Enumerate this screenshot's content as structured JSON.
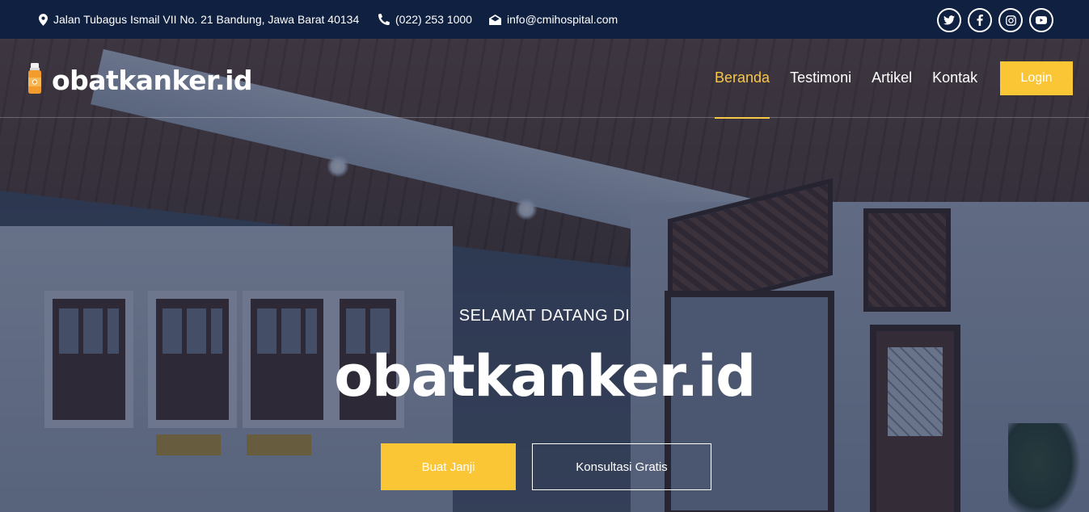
{
  "topbar": {
    "address": "Jalan Tubagus Ismail VII No. 21 Bandung, Jawa Barat 40134",
    "address_icon": "map-marker-icon",
    "phone": "(022) 253 1000",
    "phone_icon": "phone-icon",
    "email": "info@cmihospital.com",
    "email_icon": "envelope-icon",
    "socials": [
      "twitter-icon",
      "facebook-icon",
      "instagram-icon",
      "youtube-icon"
    ]
  },
  "brand": {
    "name": "obatkanker.id",
    "logo_icon": "medicine-bottle-icon"
  },
  "nav": {
    "items": [
      {
        "label": "Beranda",
        "active": true
      },
      {
        "label": "Testimoni",
        "active": false
      },
      {
        "label": "Artikel",
        "active": false
      },
      {
        "label": "Kontak",
        "active": false
      }
    ],
    "login_label": "Login"
  },
  "hero": {
    "welcome": "SELAMAT DATANG DI",
    "title": "obatkanker.id",
    "primary_cta": "Buat Janji",
    "secondary_cta": "Konsultasi Gratis"
  },
  "colors": {
    "accent": "#fbc636",
    "topbar_bg": "#102040",
    "text": "#ffffff"
  }
}
